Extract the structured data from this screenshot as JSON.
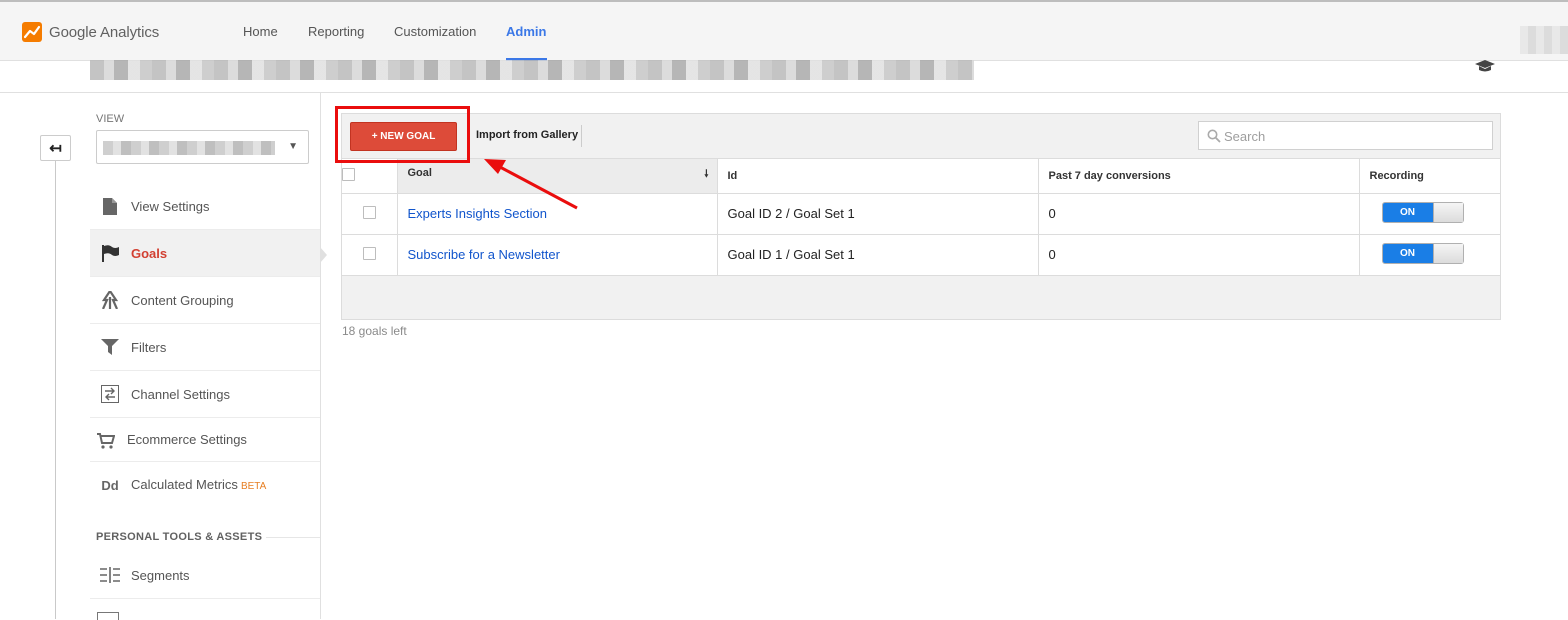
{
  "app": {
    "name": "Google Analytics"
  },
  "nav": {
    "tabs": [
      {
        "label": "Home"
      },
      {
        "label": "Reporting"
      },
      {
        "label": "Customization"
      },
      {
        "label": "Admin"
      }
    ],
    "active_tab": "Admin"
  },
  "sidebar": {
    "view_label": "VIEW",
    "items": [
      {
        "label": "View Settings",
        "icon": "document-icon"
      },
      {
        "label": "Goals",
        "icon": "flag-icon"
      },
      {
        "label": "Content Grouping",
        "icon": "content-grouping-icon"
      },
      {
        "label": "Filters",
        "icon": "filter-icon"
      },
      {
        "label": "Channel Settings",
        "icon": "channel-icon"
      },
      {
        "label": "Ecommerce Settings",
        "icon": "cart-icon"
      },
      {
        "label": "Calculated Metrics",
        "icon": "calculated-metrics-icon",
        "badge": "BETA"
      }
    ],
    "active_item": "Goals",
    "section_title": "PERSONAL TOOLS & ASSETS",
    "section_items": [
      {
        "label": "Segments",
        "icon": "segments-icon"
      }
    ]
  },
  "toolbar": {
    "new_goal_label": "+ NEW GOAL",
    "import_label": "Import from Gallery",
    "search_placeholder": "Search"
  },
  "table": {
    "headers": [
      "Goal",
      "Id",
      "Past 7 day conversions",
      "Recording"
    ],
    "rows": [
      {
        "goal": "Experts Insights Section",
        "id": "Goal ID 2 / Goal Set 1",
        "conversions": "0",
        "recording": "ON"
      },
      {
        "goal": "Subscribe for a Newsletter",
        "id": "Goal ID 1 / Goal Set 1",
        "conversions": "0",
        "recording": "ON"
      }
    ]
  },
  "footer": {
    "goals_left": "18 goals left"
  },
  "colors": {
    "accent": "#3b78e7",
    "new_goal": "#dd4b39",
    "toggle_on": "#1a7ee6",
    "annotation": "#ea0d0d",
    "active_menu": "#d23f31"
  }
}
